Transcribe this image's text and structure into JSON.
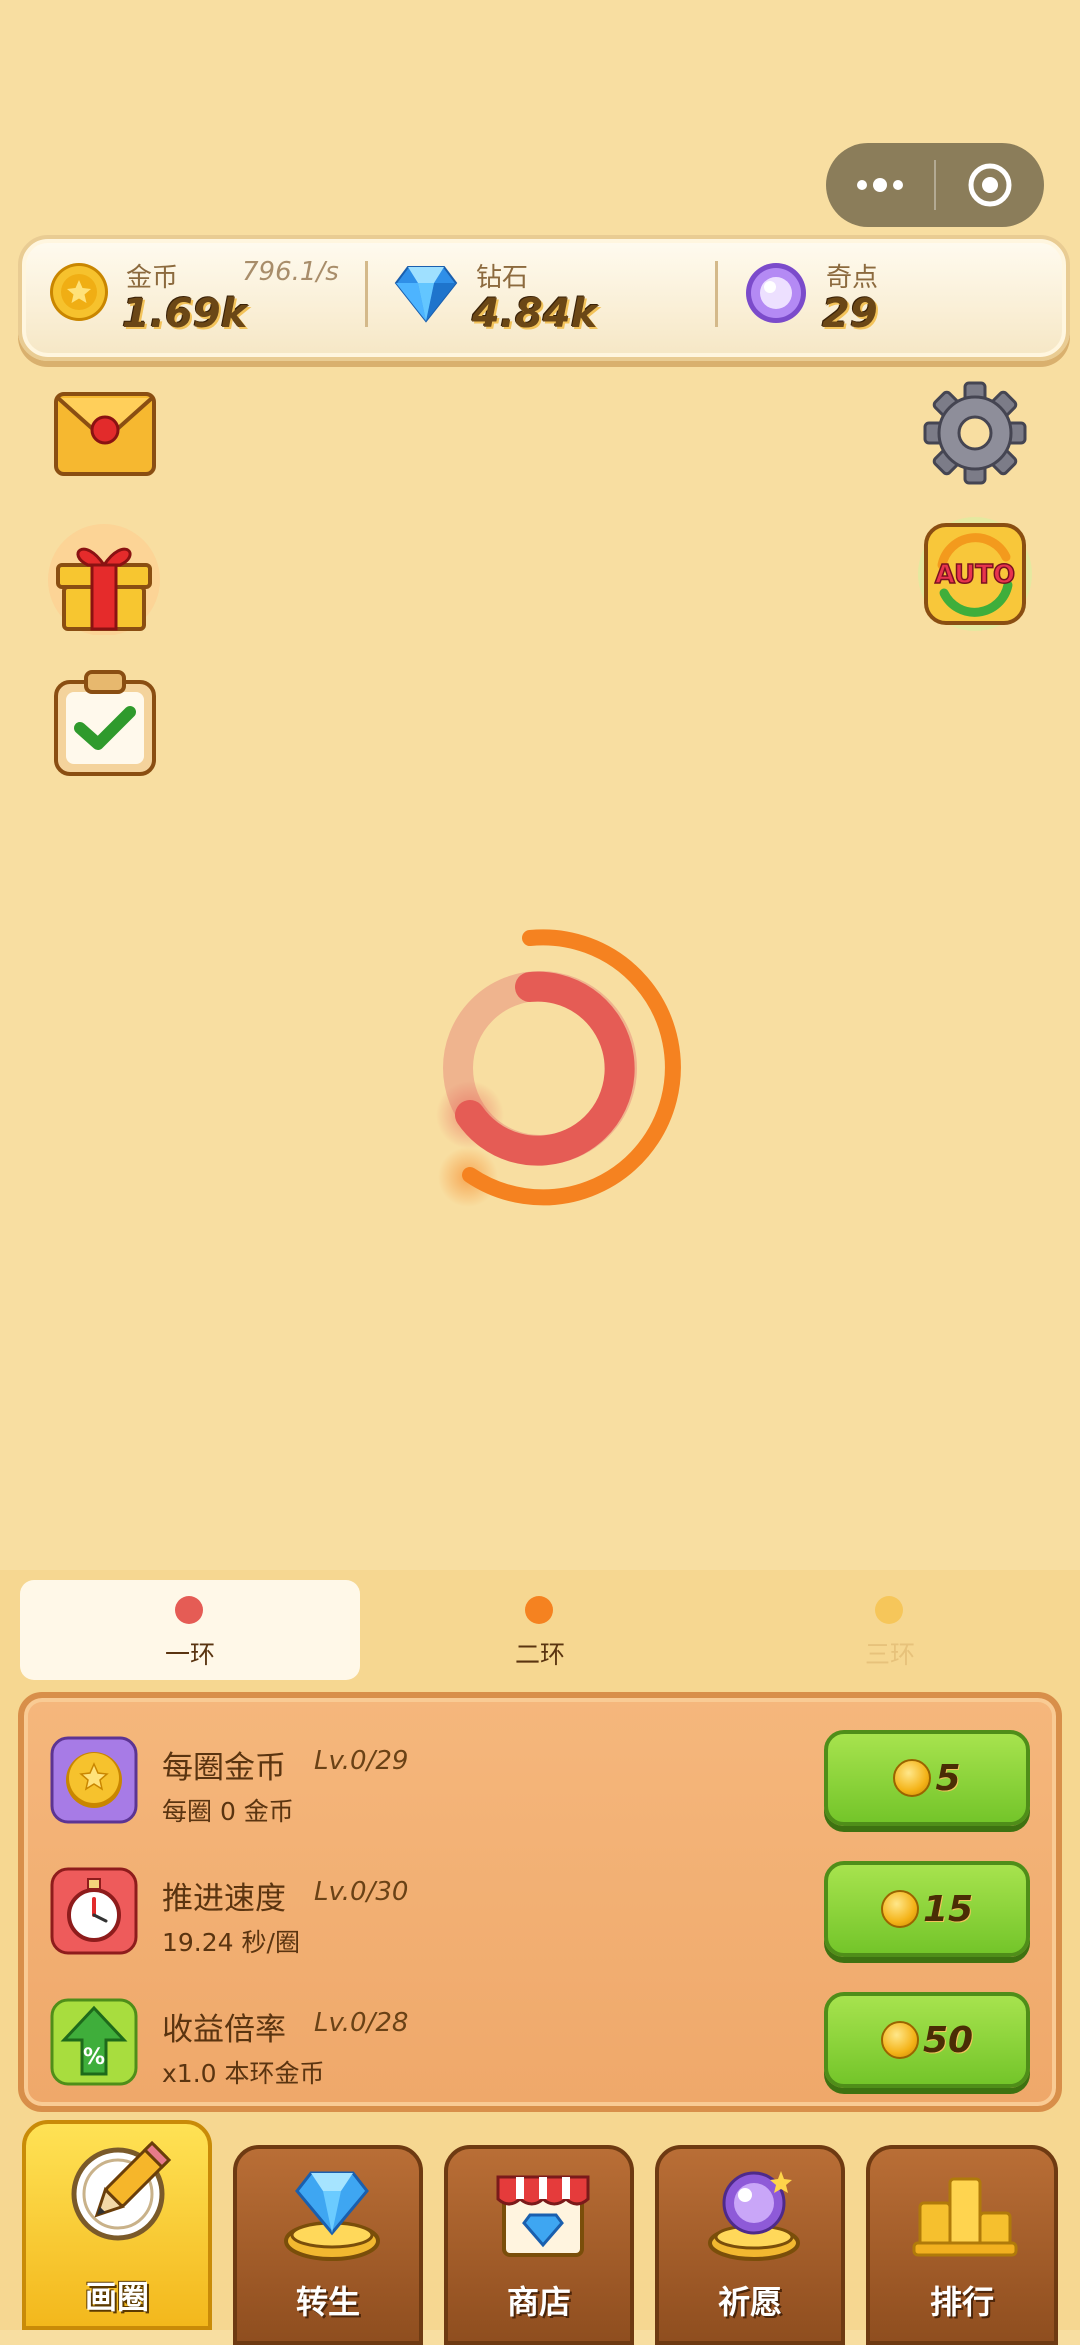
{
  "capsule": {
    "more_icon": "more-dots-icon",
    "close_icon": "target-close-icon"
  },
  "resources": {
    "gold": {
      "name": "金币",
      "value": "1.69k",
      "rate": "796.1/s",
      "icon": "gold-coin-icon"
    },
    "diamond": {
      "name": "钻石",
      "value": "4.84k",
      "icon": "diamond-icon"
    },
    "odd": {
      "name": "奇点",
      "value": "29",
      "icon": "purple-orb-icon"
    }
  },
  "side_buttons": {
    "left": [
      "mail-icon",
      "gift-icon",
      "clipboard-check-icon"
    ],
    "right": [
      "gear-icon",
      "auto-icon"
    ],
    "auto_text": "AUTO"
  },
  "ring_tabs": [
    {
      "label": "一环",
      "color": "#E55C55",
      "active": true
    },
    {
      "label": "二环",
      "color": "#F58220",
      "active": false
    },
    {
      "label": "三环",
      "color": "#F6C65A",
      "active": false
    }
  ],
  "upgrades": [
    {
      "title": "每圈金币",
      "level": "Lv.0/29",
      "desc": "每圈 0 金币",
      "cost": "5",
      "icon": "star-coin-icon"
    },
    {
      "title": "推进速度",
      "level": "Lv.0/30",
      "desc": "19.24 秒/圈",
      "cost": "15",
      "icon": "stopwatch-icon"
    },
    {
      "title": "收益倍率",
      "level": "Lv.0/28",
      "desc": "x1.0 本环金币",
      "cost": "50",
      "icon": "percent-arrow-icon"
    }
  ],
  "nav": [
    {
      "label": "画圈",
      "icon": "pencil-circle-icon",
      "active": true
    },
    {
      "label": "转生",
      "icon": "rebirth-diamond-icon",
      "active": false
    },
    {
      "label": "商店",
      "icon": "shop-icon",
      "active": false
    },
    {
      "label": "祈愿",
      "icon": "wish-orb-icon",
      "active": false
    },
    {
      "label": "排行",
      "icon": "podium-icon",
      "active": false
    }
  ],
  "colors": {
    "background": "#F8DEA1",
    "ring_inner": "#E55C55",
    "ring_outer": "#F58220",
    "button_green": "#8BD43A",
    "nav_active": "#F9CB2B",
    "nav_inactive": "#A5602B"
  }
}
